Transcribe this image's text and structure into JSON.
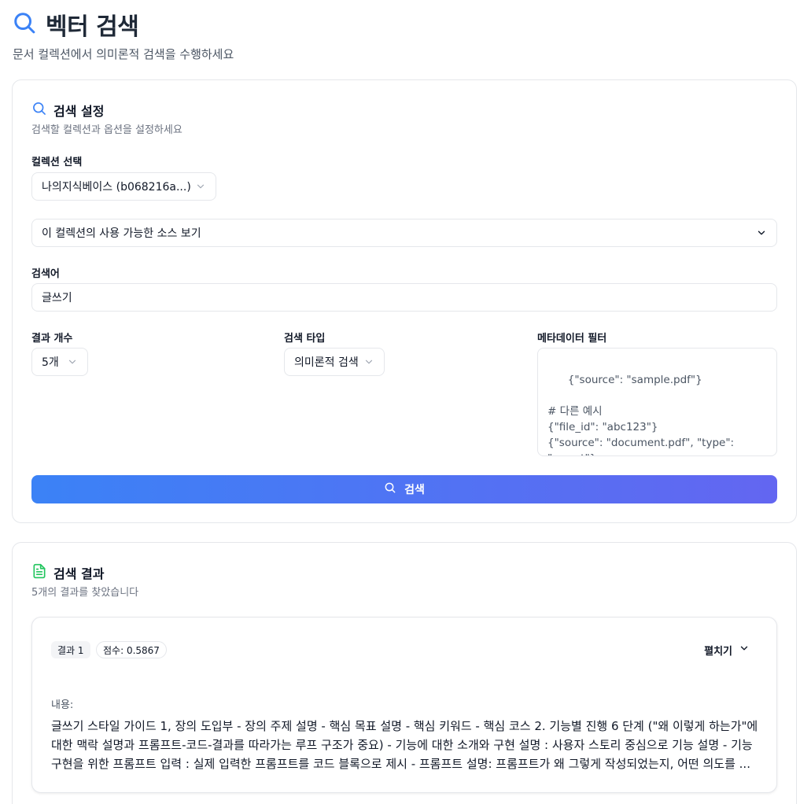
{
  "header": {
    "title": "벡터 검색",
    "subtitle": "문서 컬렉션에서 의미론적 검색을 수행하세요"
  },
  "settings": {
    "title": "검색 설정",
    "description": "검색할 컬렉션과 옵션을 설정하세요",
    "collection_label": "컬렉션 선택",
    "collection_value": "나의지식베이스 (b068216a...)",
    "sources_toggle": "이 컬렉션의 사용 가능한 소스 보기",
    "query_label": "검색어",
    "query_value": "글쓰기",
    "count_label": "결과 개수",
    "count_value": "5개",
    "type_label": "검색 타입",
    "type_value": "의미론적 검색",
    "filter_label": "메타데이터 필터",
    "filter_placeholder": "{\"source\": \"sample.pdf\"}\n\n# 다른 예시\n{\"file_id\": \"abc123\"}\n{\"source\": \"document.pdf\", \"type\": \"report\"}",
    "search_button": "검색"
  },
  "results": {
    "title": "검색 결과",
    "summary": "5개의 결과를 찾았습니다",
    "items": [
      {
        "rank": "결과 1",
        "score": "점수: 0.5867",
        "expand_label": "펼치기",
        "content_label": "내용:",
        "content": "글쓰기 스타일 가이드 1, 장의 도입부 - 장의 주제 설명 - 핵심 목표 설명 - 핵심 키워드 - 핵심 코스 2. 기능별 진행 6 단계 (\"왜 이렇게 하는가\"에 대한 맥락 설명과 프롬프트-코드-결과를 따라가는 루프 구조가 중요) - 기능에 대한 소개와 구현 설명 : 사용자 스토리 중심으로 기능 설명 - 기능 구현을 위한 프롬프트 입력 : 실제 입력한 프롬프트를 코드 블록으로 제시 - 프롬프트 설명: 프롬프트가 왜 그렇게 작성되었는지, 어떤 의도를 ..."
      }
    ]
  },
  "colors": {
    "accent_blue": "#3b82f6",
    "accent_indigo": "#6366f1",
    "result_icon_green": "#22c55e"
  }
}
